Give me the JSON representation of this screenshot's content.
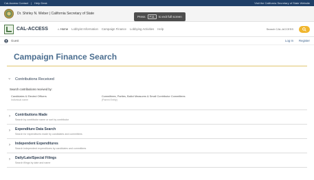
{
  "topbar": {
    "left": [
      "Cal-Access Contact",
      "|",
      "Help Desk"
    ],
    "right": "Visit the California Secretary of State Website"
  },
  "banner": {
    "officer": "Dr. Shirley N. Weber  |  California Secretary of State"
  },
  "fullscreen_toast": {
    "prefix": "Press",
    "key": "F11",
    "suffix": "to exit full screen"
  },
  "nav": {
    "brand": "CAL-ACCESS",
    "items": [
      "Home",
      "Lobbyist Information",
      "Campaign Finance",
      "Lobbying Activities",
      "Help"
    ],
    "search_label": "Search CAL-ACCESS"
  },
  "subbar": {
    "user": "Guest",
    "login": "Log In",
    "register": "Register"
  },
  "page": {
    "title": "Campaign Finance Search"
  },
  "sections": {
    "open": {
      "title": "Contributions Received",
      "lead": "Search contributions received by:",
      "options": [
        {
          "name": "Candidates & Elected Officers",
          "sub": "Individual name"
        },
        {
          "name": "Committees, Parties, Ballot Measures & Small Contributor Committees",
          "sub": "(Parent Entity)"
        }
      ]
    },
    "collapsed": [
      {
        "title": "Contributions Made",
        "desc": "Search by contributor name or sort by contributor"
      },
      {
        "title": "Expenditure Data Search",
        "desc": "Search for expenditures made by candidates and committees"
      },
      {
        "title": "Independent Expenditures",
        "desc": "Search independent expenditures by candidates and committees"
      },
      {
        "title": "Daily/Late/Special Filings",
        "desc": "Search filings by date and name"
      }
    ]
  }
}
